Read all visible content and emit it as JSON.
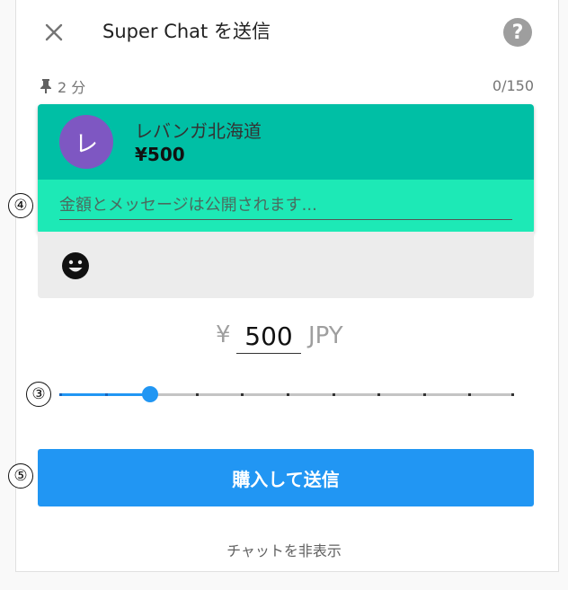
{
  "header": {
    "title": "Super Chat を送信",
    "close_icon": "close-icon",
    "help_icon": "help-icon",
    "help_glyph": "?"
  },
  "pin": {
    "icon": "pin-icon",
    "duration": "2 分"
  },
  "message_counter": "0/150",
  "card": {
    "avatar_letter": "レ",
    "channel_name": "レバンガ北海道",
    "amount": "¥500",
    "message_placeholder": "金額とメッセージは公開されます...",
    "message_value": "",
    "top_color": "#00bfa5",
    "bottom_color": "#1de9b6",
    "avatar_color": "#7e57c2"
  },
  "emoji_icon": "smiley-face-icon",
  "amount_entry": {
    "currency_symbol": "¥",
    "value": "500",
    "currency_code": "JPY"
  },
  "slider": {
    "steps": 11,
    "selected_index": 2,
    "accent": "#2196f3"
  },
  "markers": {
    "message": "④",
    "slider": "③",
    "buy": "⑤"
  },
  "buy_button_label": "購入して送信",
  "hide_chat_label": "チャットを非表示"
}
